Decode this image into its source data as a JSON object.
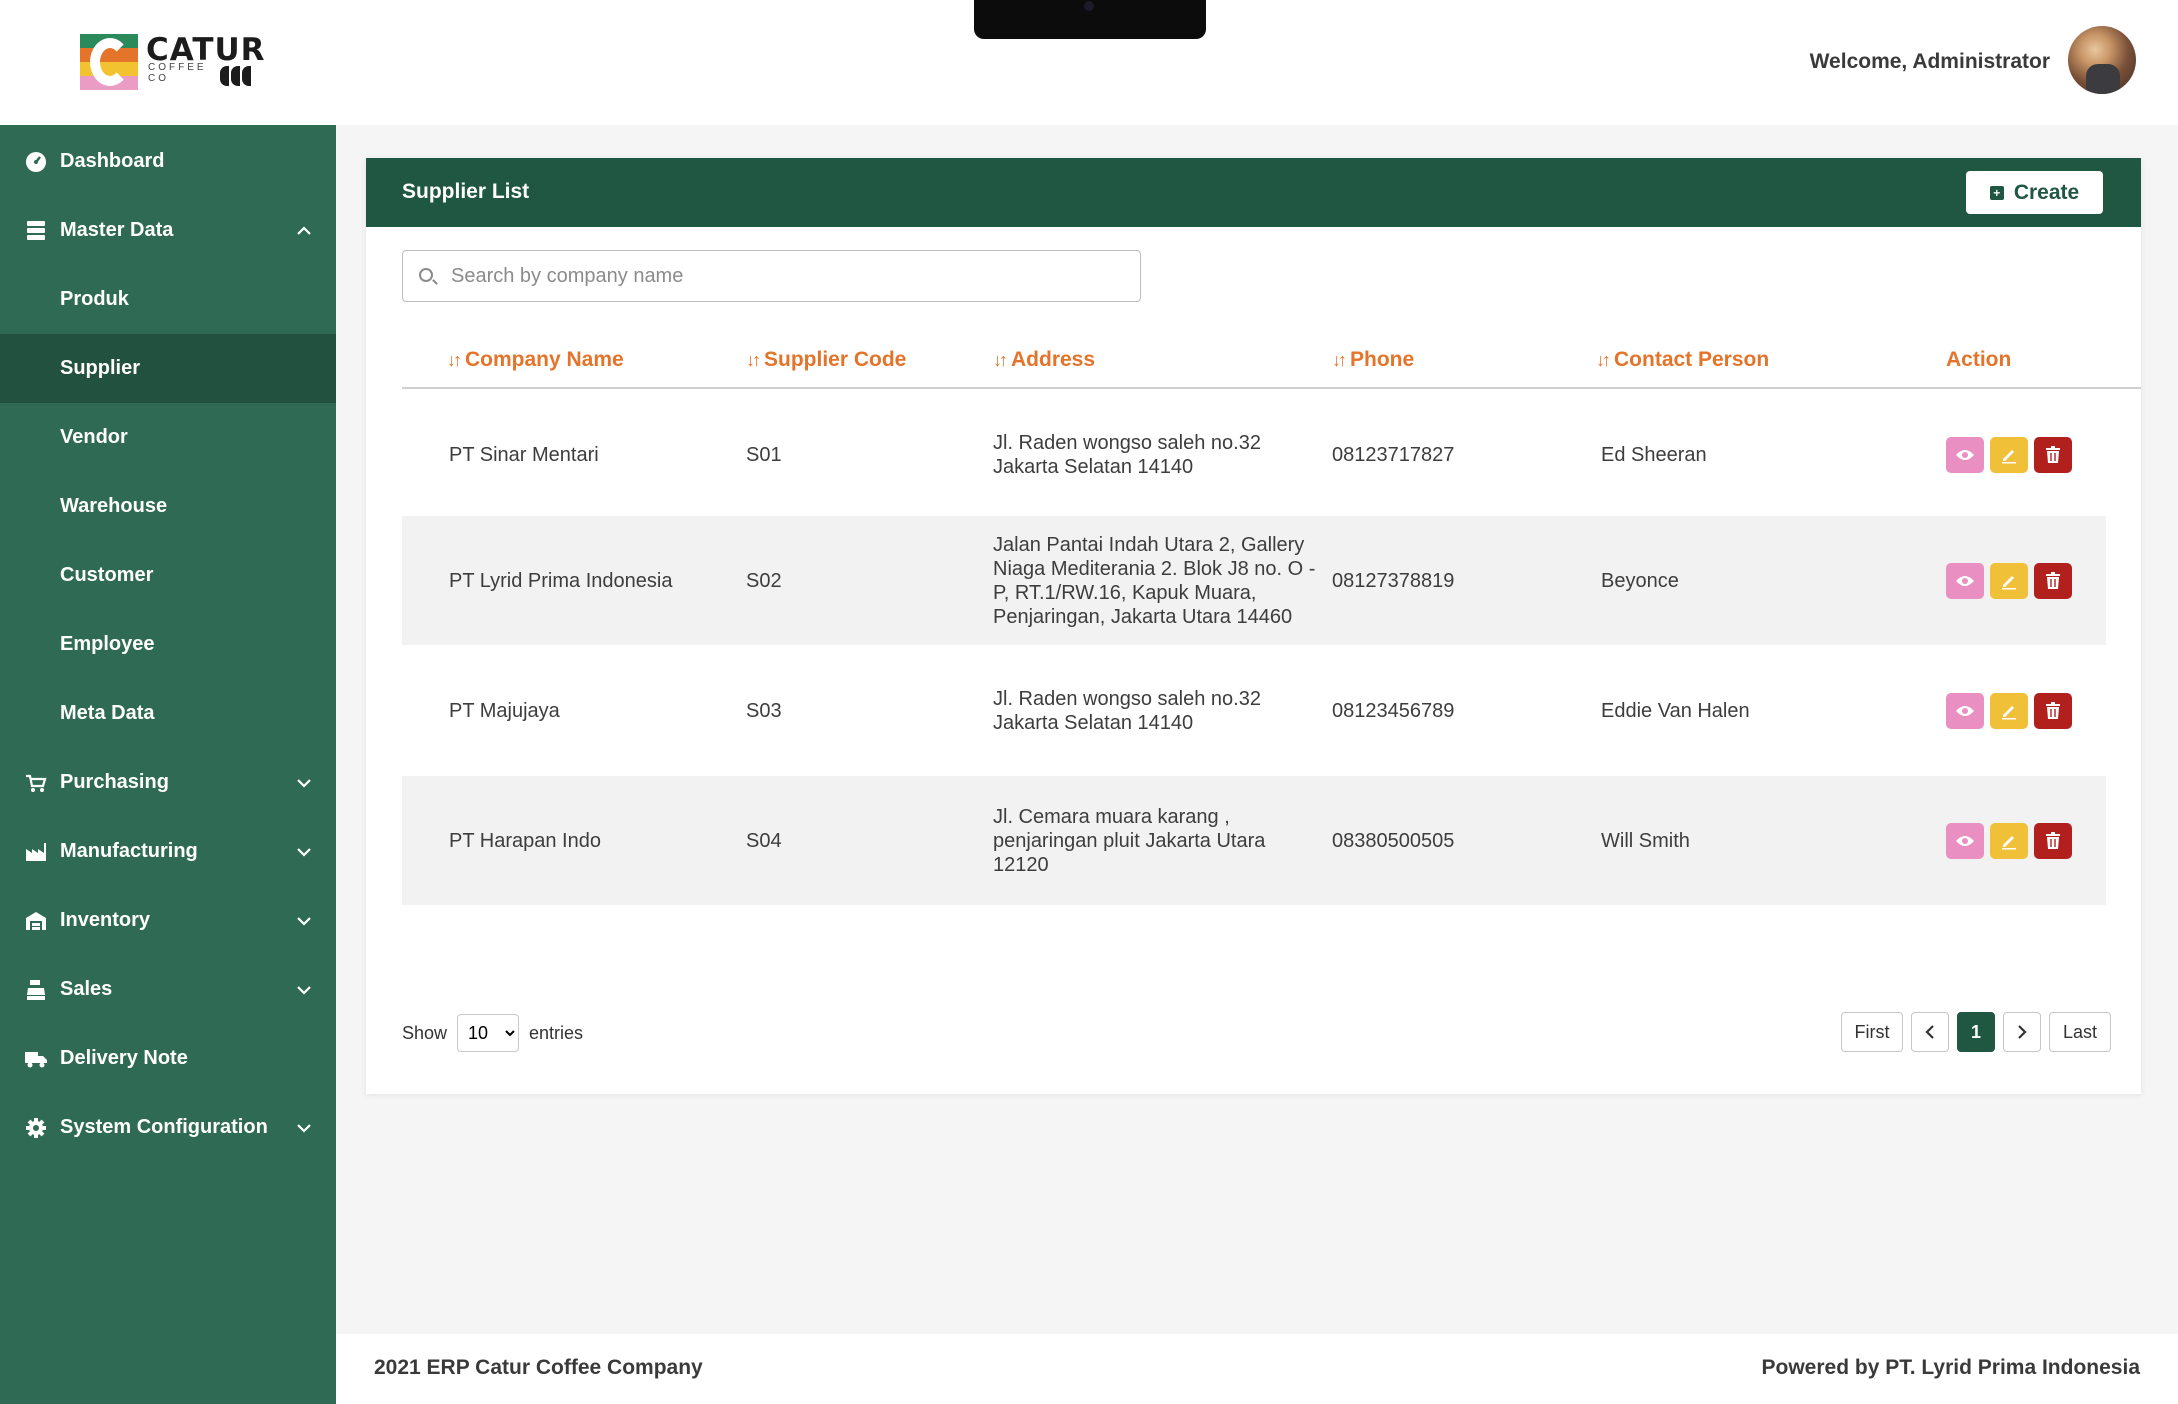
{
  "header": {
    "brand_name": "CATUR",
    "brand_sub": "COFFEE CO",
    "welcome": "Welcome, Administrator"
  },
  "sidebar": {
    "items": [
      {
        "label": "Dashboard",
        "icon": "dashboard-icon"
      },
      {
        "label": "Master Data",
        "icon": "database-icon",
        "expanded": true
      },
      {
        "label": "Produk"
      },
      {
        "label": "Supplier",
        "active": true
      },
      {
        "label": "Vendor"
      },
      {
        "label": "Warehouse"
      },
      {
        "label": "Customer"
      },
      {
        "label": "Employee"
      },
      {
        "label": "Meta Data"
      },
      {
        "label": "Purchasing",
        "icon": "cart-icon"
      },
      {
        "label": "Manufacturing",
        "icon": "factory-icon"
      },
      {
        "label": "Inventory",
        "icon": "warehouse-icon"
      },
      {
        "label": "Sales",
        "icon": "cash-register-icon"
      },
      {
        "label": "Delivery Note",
        "icon": "truck-icon"
      },
      {
        "label": "System Configuration",
        "icon": "gear-icon"
      }
    ]
  },
  "main": {
    "title": "Supplier List",
    "create_label": "Create",
    "search_placeholder": "Search by company name",
    "columns": [
      "Company Name",
      "Supplier Code",
      "Address",
      "Phone",
      "Contact Person",
      "Action"
    ],
    "rows": [
      {
        "company": "PT Sinar Mentari",
        "code": "S01",
        "address": "Jl. Raden wongso saleh no.32 Jakarta Selatan 14140",
        "phone": "08123717827",
        "contact": "Ed Sheeran"
      },
      {
        "company": "PT Lyrid Prima Indonesia",
        "code": "S02",
        "address": "Jalan Pantai Indah Utara 2, Gallery Niaga Mediterania 2. Blok J8 no. O - P, RT.1/RW.16, Kapuk Muara, Penjaringan, Jakarta Utara 14460",
        "phone": "08127378819",
        "contact": "Beyonce"
      },
      {
        "company": "PT Majujaya",
        "code": "S03",
        "address": "Jl. Raden wongso saleh no.32 Jakarta Selatan 14140",
        "phone": "08123456789",
        "contact": "Eddie Van Halen"
      },
      {
        "company": "PT Harapan Indo",
        "code": "S04",
        "address": "Jl. Cemara muara karang , penjaringan pluit  Jakarta Utara 12120",
        "phone": "08380500505",
        "contact": "Will Smith"
      }
    ],
    "show_label": "Show",
    "entries_label": "entries",
    "page_size": "10",
    "pager": {
      "first": "First",
      "prev": "‹",
      "current": "1",
      "next": "›",
      "last": "Last"
    }
  },
  "footer": {
    "left": "2021 ERP Catur Coffee Company",
    "right": "Powered by PT. Lyrid Prima Indonesia"
  },
  "colors": {
    "sidebar": "#2f6b54",
    "sidebar_active": "#23513f",
    "header_bar": "#1f5743",
    "accent_orange": "#e5742b",
    "view_btn": "#e98fc1",
    "edit_btn": "#f0c138",
    "delete_btn": "#b2201e"
  }
}
